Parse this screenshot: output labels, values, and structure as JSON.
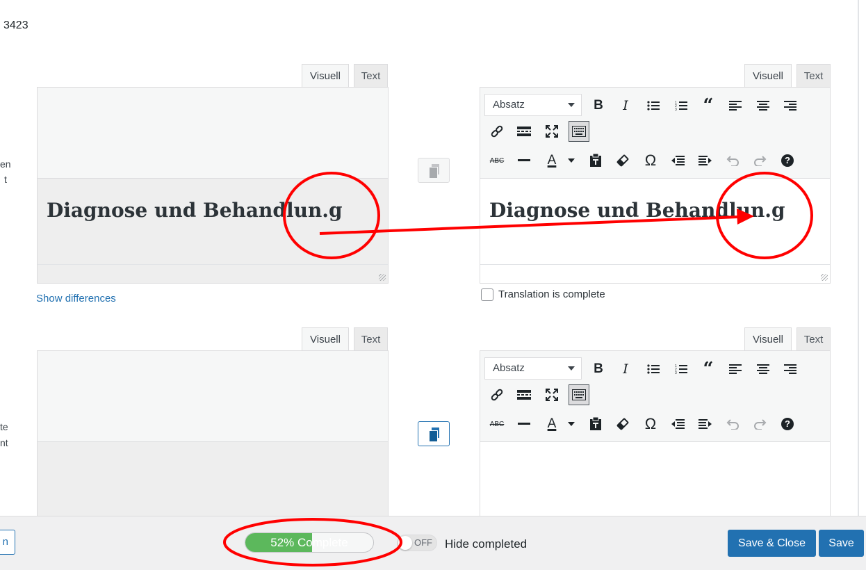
{
  "header": {
    "id_fragment": "3423"
  },
  "side_fragments": {
    "row1_a": "en",
    "row1_b": "t",
    "row2_a": "te",
    "row2_b": "nt"
  },
  "tabs": {
    "visual": "Visuell",
    "text": "Text"
  },
  "toolbar": {
    "format_select": "Absatz",
    "row1_icons": [
      "bold-icon",
      "italic-icon",
      "bullet-list-icon",
      "numbered-list-icon",
      "blockquote-icon",
      "align-left-icon",
      "align-center-icon",
      "align-right-icon"
    ],
    "row2_icons": [
      "link-icon",
      "read-more-icon",
      "fullscreen-icon",
      "toolbar-toggle-icon"
    ],
    "row3_icons": [
      "strikethrough-icon",
      "horizontal-rule-icon",
      "text-color-icon",
      "paste-text-icon",
      "clear-formatting-icon",
      "special-character-icon",
      "outdent-icon",
      "indent-icon",
      "undo-icon",
      "redo-icon",
      "help-icon"
    ],
    "strikethrough_glyph": "ABC",
    "text_color_glyph": "A",
    "omega_glyph": "Ω",
    "help_glyph": "?"
  },
  "row1": {
    "source_heading": "Diagnose und Behandlun.g",
    "translation_heading": "Diagnose und Behandlun.g",
    "show_differences": "Show differences",
    "translation_complete_label": "Translation is complete",
    "translation_complete_checked": false
  },
  "row2": {
    "source_heading": "",
    "translation_heading": ""
  },
  "footer": {
    "left_button_fragment": "n",
    "progress_label": "52% Complete",
    "progress_percent": 52,
    "toggle_state": "OFF",
    "hide_completed_label": "Hide completed",
    "save_close_label": "Save & Close",
    "save_label": "Save"
  },
  "colors": {
    "accent": "#2271b1",
    "progress": "#5cb85c",
    "annotation": "#ff0000"
  }
}
